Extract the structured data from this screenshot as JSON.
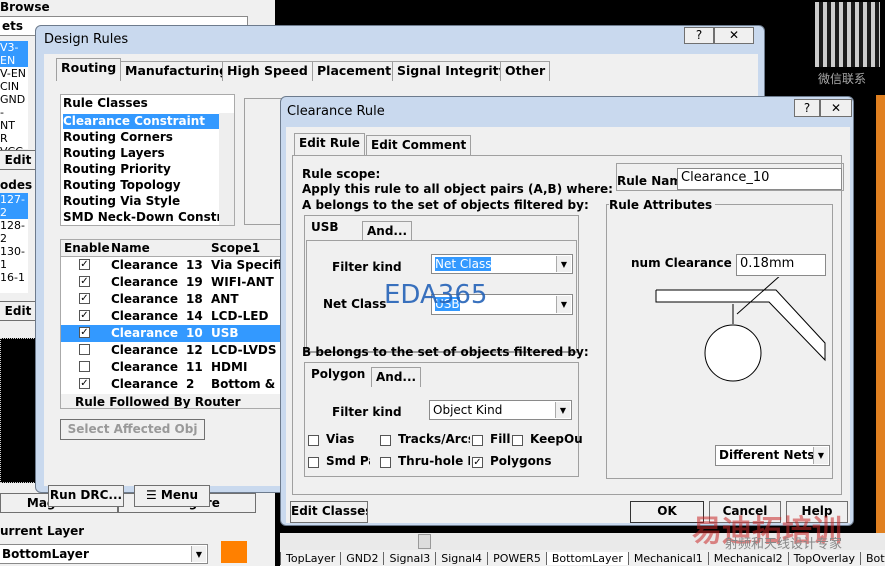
{
  "left_panel": {
    "browse_label": "Browse",
    "nets_dropdown": "ets",
    "nets": [
      "V3-EN",
      "V-EN",
      "CIN",
      "GND",
      "-",
      "NT",
      "R",
      "VCC"
    ],
    "edit_label": "Edit",
    "nodes_header": "odes",
    "nodes": [
      "127-2",
      "128-2",
      "130-1",
      "16-1"
    ],
    "magnifier": "Magnifier",
    "configure": "Configure",
    "current_layer_label": "urrent Layer",
    "current_layer": "BottomLayer",
    "layer_color": "#ff8000"
  },
  "design_rules": {
    "title": "Design Rules",
    "tabs": [
      "Routing",
      "Manufacturing",
      "High Speed",
      "Placement",
      "Signal Integrity",
      "Other"
    ],
    "rule_classes_header": "Rule Classes",
    "rule_classes": [
      "Clearance Constraint",
      "Routing Corners",
      "Routing Layers",
      "Routing Priority",
      "Routing Topology",
      "Routing Via Style",
      "SMD Neck-Down Constra"
    ],
    "constraint_group": "Clearance Constraint",
    "columns": [
      "Enable",
      "Name",
      "Scope1"
    ],
    "rules": [
      {
        "enabled": true,
        "name": "Clearance",
        "num": "13",
        "scope": "Via Specific"
      },
      {
        "enabled": true,
        "name": "Clearance",
        "num": "19",
        "scope": "WIFI-ANT"
      },
      {
        "enabled": true,
        "name": "Clearance",
        "num": "18",
        "scope": "ANT"
      },
      {
        "enabled": true,
        "name": "Clearance",
        "num": "14",
        "scope": "LCD-LED"
      },
      {
        "enabled": true,
        "name": "Clearance",
        "num": "10",
        "scope": "USB",
        "selected": true
      },
      {
        "enabled": false,
        "name": "Clearance",
        "num": "12",
        "scope": "LCD-LVDS"
      },
      {
        "enabled": false,
        "name": "Clearance",
        "num": "11",
        "scope": "HDMI"
      },
      {
        "enabled": true,
        "name": "Clearance",
        "num": "2",
        "scope": "Bottom & C"
      }
    ],
    "footer_label": "Rule Followed By Router",
    "select_affected": "Select Affected Obj",
    "run_drc": "Run DRC...",
    "menu": "Menu"
  },
  "clearance_rule": {
    "title": "Clearance Rule",
    "tabs": [
      "Edit Rule",
      "Edit Comment"
    ],
    "scope_l1": "Rule scope:",
    "scope_l2": "Apply this rule to all object pairs (A,B) where:",
    "scope_l3": "A belongs to the set of objects filtered by:",
    "a_tabs": [
      "USB",
      "And..."
    ],
    "a_filter_kind_label": "Filter kind",
    "a_filter_kind": "Net Class",
    "a_net_class_label": "Net Class",
    "a_net_class": "USB",
    "b_label": "B belongs to the set of objects filtered by:",
    "b_tabs": [
      "Polygon",
      "And..."
    ],
    "b_filter_kind_label": "Filter kind",
    "b_filter_kind": "Object Kind",
    "objects": [
      {
        "label": "Vias",
        "checked": false
      },
      {
        "label": "Tracks/Arcs",
        "checked": false
      },
      {
        "label": "Fill",
        "checked": false
      },
      {
        "label": "KeepOu",
        "checked": false
      },
      {
        "label": "Smd Pa",
        "checked": false
      },
      {
        "label": "Thru-hole P",
        "checked": false
      },
      {
        "label": "Polygons",
        "checked": true
      }
    ],
    "rule_name_label": "Rule Nam",
    "rule_name": "Clearance_10",
    "attributes_label": "Rule Attributes",
    "min_clearance_label": "num Clearance",
    "min_clearance": "0.18mm",
    "net_scope": "Different Nets",
    "edit_classes": "Edit Classes",
    "ok": "OK",
    "cancel": "Cancel",
    "help": "Help"
  },
  "layer_tabs": [
    "TopLayer",
    "GND2",
    "Signal3",
    "Signal4",
    "POWER5",
    "BottomLayer",
    "Mechanical1",
    "Mechanical2",
    "TopOverlay",
    "BottomOverlay",
    "B"
  ],
  "watermarks": {
    "eda": "EDA365",
    "cn1": "易迪拓培训",
    "cn2": "射频和天线设计专家",
    "qr": "微信联系"
  }
}
